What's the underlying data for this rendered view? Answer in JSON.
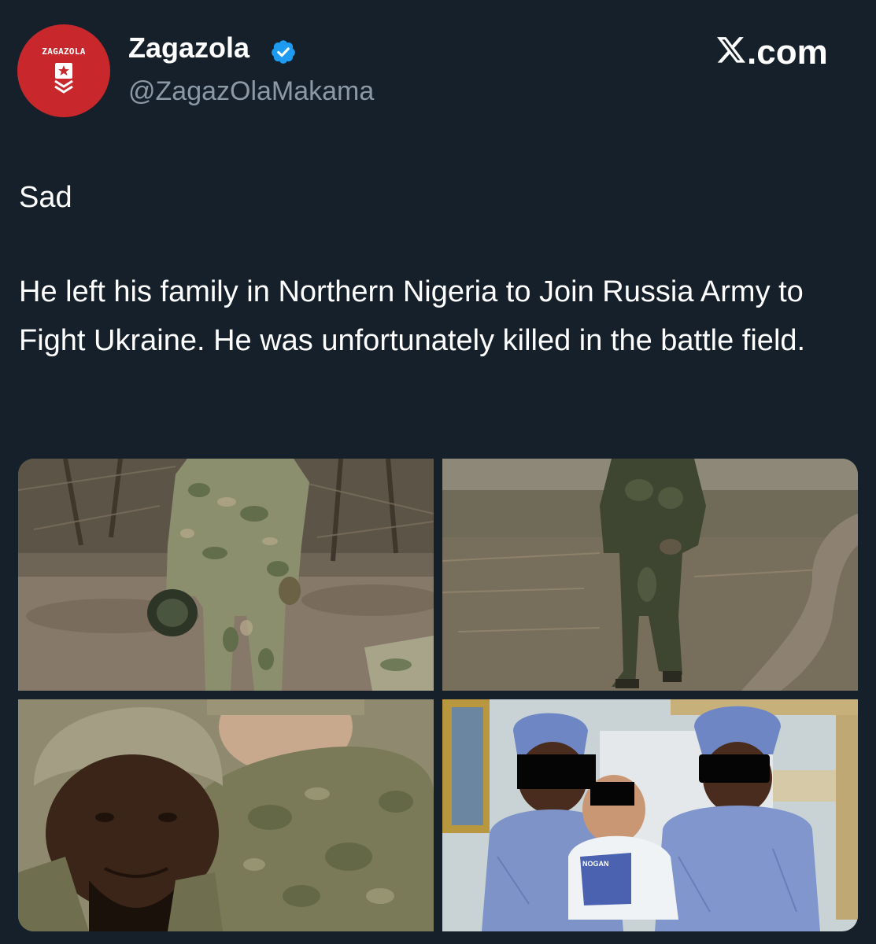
{
  "post": {
    "avatar_text": "ZAGAZOLA",
    "display_name": "Zagazola",
    "handle": "@ZagazOlaMakama",
    "brand": ".com",
    "text_line1": "Sad",
    "text_body": "He left his family in Northern Nigeria to Join Russia Army to Fight Ukraine. He was unfortunately killed in the battle field."
  },
  "media": {
    "onesie_text": "NOGAN"
  },
  "colors": {
    "background": "#15202b",
    "secondary_text": "#8b98a5",
    "verified_badge": "#1d9bf0",
    "avatar": "#c8282c"
  },
  "icons": [
    "verified-badge-icon",
    "x-logo-icon",
    "star-icon",
    "chevron-icon"
  ]
}
